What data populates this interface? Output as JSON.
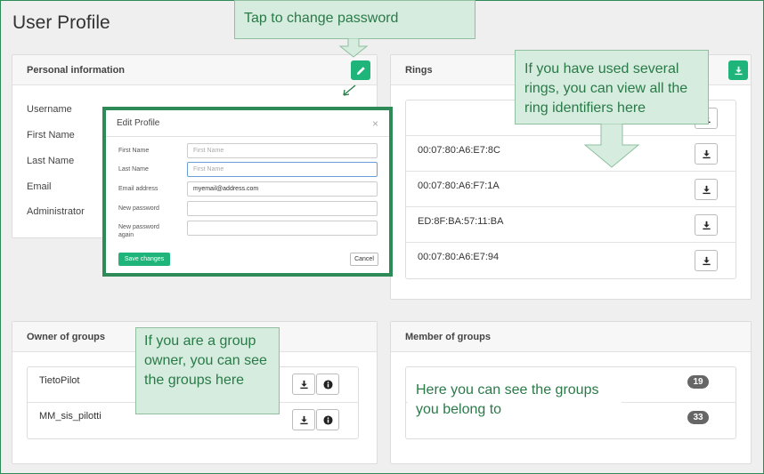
{
  "page": {
    "title": "User Profile"
  },
  "personal": {
    "heading": "Personal information",
    "fields": [
      "Username",
      "First Name",
      "Last Name",
      "Email",
      "Administrator"
    ]
  },
  "rings": {
    "heading": "Rings",
    "items": [
      "",
      "00:07:80:A6:E7:8C",
      "00:07:80:A6:F7:1A",
      "ED:8F:BA:57:11:BA",
      "00:07:80:A6:E7:94"
    ]
  },
  "owner_groups": {
    "heading": "Owner of groups",
    "items": [
      "TietoPilot",
      "MM_sis_pilotti"
    ]
  },
  "member_groups": {
    "heading": "Member of groups",
    "badges": [
      "19",
      "33"
    ]
  },
  "modal": {
    "title": "Edit Profile",
    "close": "×",
    "fields": [
      {
        "label": "First Name",
        "value": "First Name"
      },
      {
        "label": "Last Name",
        "value": "First Name"
      },
      {
        "label": "Email address",
        "value": "myemail@address.com"
      },
      {
        "label": "New password",
        "value": ""
      },
      {
        "label": "New password again",
        "value": ""
      }
    ],
    "save": "Save changes",
    "cancel": "Cancel"
  },
  "callouts": {
    "password": "Tap to change password",
    "rings": "If you have used several rings, you can view all the ring identifiers here",
    "owner": "If you are a group owner, you can see the groups here",
    "member": "Here you can see the groups you belong to"
  },
  "colors": {
    "accent": "#1fb57a",
    "frame": "#2e8b57",
    "callout_bg": "#d5ecdf",
    "callout_text": "#2a7a48"
  },
  "icons": [
    "pencil-icon",
    "download-icon",
    "info-icon",
    "close-icon"
  ]
}
